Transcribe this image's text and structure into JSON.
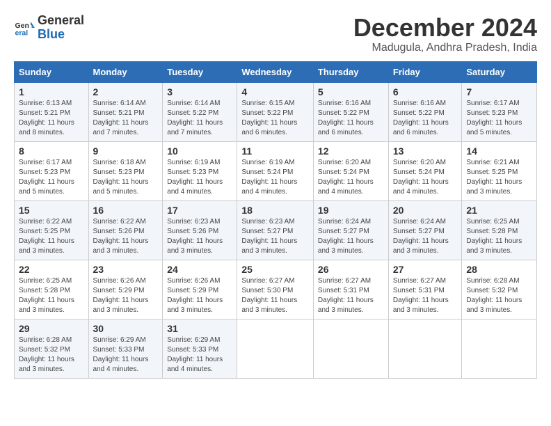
{
  "logo": {
    "general": "General",
    "blue": "Blue"
  },
  "title": "December 2024",
  "location": "Madugula, Andhra Pradesh, India",
  "days_of_week": [
    "Sunday",
    "Monday",
    "Tuesday",
    "Wednesday",
    "Thursday",
    "Friday",
    "Saturday"
  ],
  "weeks": [
    [
      {
        "day": "1",
        "sunrise": "6:13 AM",
        "sunset": "5:21 PM",
        "daylight": "11 hours and 8 minutes."
      },
      {
        "day": "2",
        "sunrise": "6:14 AM",
        "sunset": "5:21 PM",
        "daylight": "11 hours and 7 minutes."
      },
      {
        "day": "3",
        "sunrise": "6:14 AM",
        "sunset": "5:22 PM",
        "daylight": "11 hours and 7 minutes."
      },
      {
        "day": "4",
        "sunrise": "6:15 AM",
        "sunset": "5:22 PM",
        "daylight": "11 hours and 6 minutes."
      },
      {
        "day": "5",
        "sunrise": "6:16 AM",
        "sunset": "5:22 PM",
        "daylight": "11 hours and 6 minutes."
      },
      {
        "day": "6",
        "sunrise": "6:16 AM",
        "sunset": "5:22 PM",
        "daylight": "11 hours and 6 minutes."
      },
      {
        "day": "7",
        "sunrise": "6:17 AM",
        "sunset": "5:23 PM",
        "daylight": "11 hours and 5 minutes."
      }
    ],
    [
      {
        "day": "8",
        "sunrise": "6:17 AM",
        "sunset": "5:23 PM",
        "daylight": "11 hours and 5 minutes."
      },
      {
        "day": "9",
        "sunrise": "6:18 AM",
        "sunset": "5:23 PM",
        "daylight": "11 hours and 5 minutes."
      },
      {
        "day": "10",
        "sunrise": "6:19 AM",
        "sunset": "5:23 PM",
        "daylight": "11 hours and 4 minutes."
      },
      {
        "day": "11",
        "sunrise": "6:19 AM",
        "sunset": "5:24 PM",
        "daylight": "11 hours and 4 minutes."
      },
      {
        "day": "12",
        "sunrise": "6:20 AM",
        "sunset": "5:24 PM",
        "daylight": "11 hours and 4 minutes."
      },
      {
        "day": "13",
        "sunrise": "6:20 AM",
        "sunset": "5:24 PM",
        "daylight": "11 hours and 4 minutes."
      },
      {
        "day": "14",
        "sunrise": "6:21 AM",
        "sunset": "5:25 PM",
        "daylight": "11 hours and 3 minutes."
      }
    ],
    [
      {
        "day": "15",
        "sunrise": "6:22 AM",
        "sunset": "5:25 PM",
        "daylight": "11 hours and 3 minutes."
      },
      {
        "day": "16",
        "sunrise": "6:22 AM",
        "sunset": "5:26 PM",
        "daylight": "11 hours and 3 minutes."
      },
      {
        "day": "17",
        "sunrise": "6:23 AM",
        "sunset": "5:26 PM",
        "daylight": "11 hours and 3 minutes."
      },
      {
        "day": "18",
        "sunrise": "6:23 AM",
        "sunset": "5:27 PM",
        "daylight": "11 hours and 3 minutes."
      },
      {
        "day": "19",
        "sunrise": "6:24 AM",
        "sunset": "5:27 PM",
        "daylight": "11 hours and 3 minutes."
      },
      {
        "day": "20",
        "sunrise": "6:24 AM",
        "sunset": "5:27 PM",
        "daylight": "11 hours and 3 minutes."
      },
      {
        "day": "21",
        "sunrise": "6:25 AM",
        "sunset": "5:28 PM",
        "daylight": "11 hours and 3 minutes."
      }
    ],
    [
      {
        "day": "22",
        "sunrise": "6:25 AM",
        "sunset": "5:28 PM",
        "daylight": "11 hours and 3 minutes."
      },
      {
        "day": "23",
        "sunrise": "6:26 AM",
        "sunset": "5:29 PM",
        "daylight": "11 hours and 3 minutes."
      },
      {
        "day": "24",
        "sunrise": "6:26 AM",
        "sunset": "5:29 PM",
        "daylight": "11 hours and 3 minutes."
      },
      {
        "day": "25",
        "sunrise": "6:27 AM",
        "sunset": "5:30 PM",
        "daylight": "11 hours and 3 minutes."
      },
      {
        "day": "26",
        "sunrise": "6:27 AM",
        "sunset": "5:31 PM",
        "daylight": "11 hours and 3 minutes."
      },
      {
        "day": "27",
        "sunrise": "6:27 AM",
        "sunset": "5:31 PM",
        "daylight": "11 hours and 3 minutes."
      },
      {
        "day": "28",
        "sunrise": "6:28 AM",
        "sunset": "5:32 PM",
        "daylight": "11 hours and 3 minutes."
      }
    ],
    [
      {
        "day": "29",
        "sunrise": "6:28 AM",
        "sunset": "5:32 PM",
        "daylight": "11 hours and 3 minutes."
      },
      {
        "day": "30",
        "sunrise": "6:29 AM",
        "sunset": "5:33 PM",
        "daylight": "11 hours and 4 minutes."
      },
      {
        "day": "31",
        "sunrise": "6:29 AM",
        "sunset": "5:33 PM",
        "daylight": "11 hours and 4 minutes."
      },
      null,
      null,
      null,
      null
    ]
  ],
  "labels": {
    "sunrise": "Sunrise:",
    "sunset": "Sunset:",
    "daylight": "Daylight:"
  }
}
